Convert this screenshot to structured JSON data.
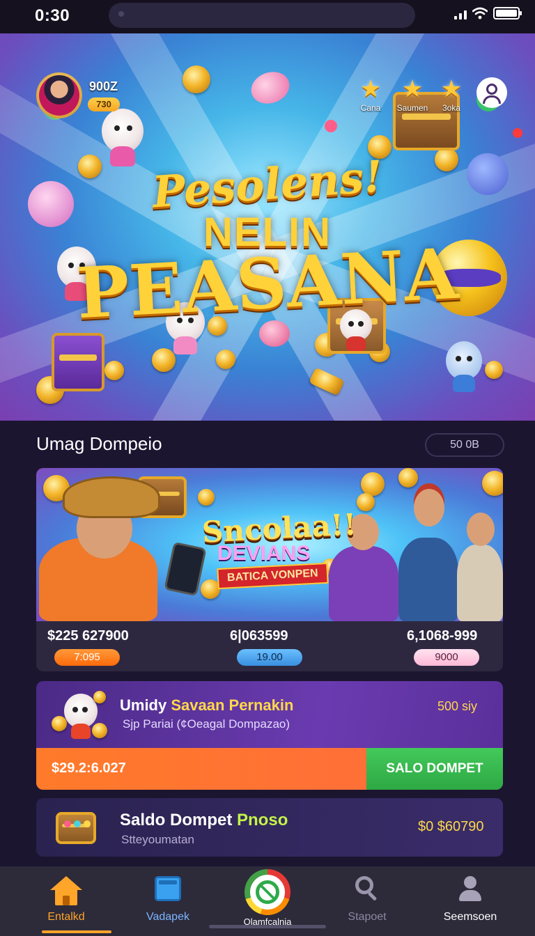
{
  "status_bar": {
    "time": "0:30"
  },
  "hero": {
    "player_score": "900Z",
    "player_level": "730",
    "tabs": [
      {
        "label": "Cana",
        "icon": "star-icon"
      },
      {
        "label": "Saumen",
        "icon": "star-icon"
      },
      {
        "label": "3oka",
        "icon": "star-icon"
      }
    ],
    "title_line1": "Pesolens!",
    "title_line2": "NELIN",
    "title_line3": "PEASANA"
  },
  "section": {
    "title": "Umag Dompeio",
    "badge": "50 0B"
  },
  "promo": {
    "title": "Sncolaa!!",
    "subtitle": "DEVIANS",
    "ribbon": "BATICA VONPEN",
    "values": [
      {
        "amount": "$225 627900",
        "chip": "7:095"
      },
      {
        "amount": "6|063599",
        "chip": "19.00"
      },
      {
        "amount": "6,1068-999",
        "chip": "9000"
      }
    ],
    "colors": {
      "chip1": "#ff7a1a",
      "chip2": "#4aa8f0",
      "chip3": "#ffc6e0"
    }
  },
  "offer": {
    "title_plain": "Umidy ",
    "title_highlight": "Savaan Pernakin",
    "subtitle": "Sjp Pariai (¢Oeagal Dompazao)",
    "price": "500 siy",
    "bar_amount": "$29.2:6.027",
    "button_label": "SALO DOMPET"
  },
  "wallet": {
    "title_plain": "Saldo Dompet ",
    "title_highlight": "Pnoso",
    "subtitle": "Stteyoumatan",
    "amount": "$0 $60790"
  },
  "bottom_nav": {
    "items": [
      {
        "label": "Entalkd",
        "icon": "home-icon",
        "active": true
      },
      {
        "label": "Vadapek",
        "icon": "card-icon"
      },
      {
        "label": "Olamfcalnia",
        "icon": "play-badge-icon"
      },
      {
        "label": "Stapoet",
        "icon": "search-icon"
      },
      {
        "label": "Seemsoen",
        "icon": "user-icon"
      }
    ]
  },
  "theme": {
    "accent": "#ffa52a",
    "background": "#1c1530",
    "gold": "#ffd23a",
    "green": "#2ea844"
  }
}
